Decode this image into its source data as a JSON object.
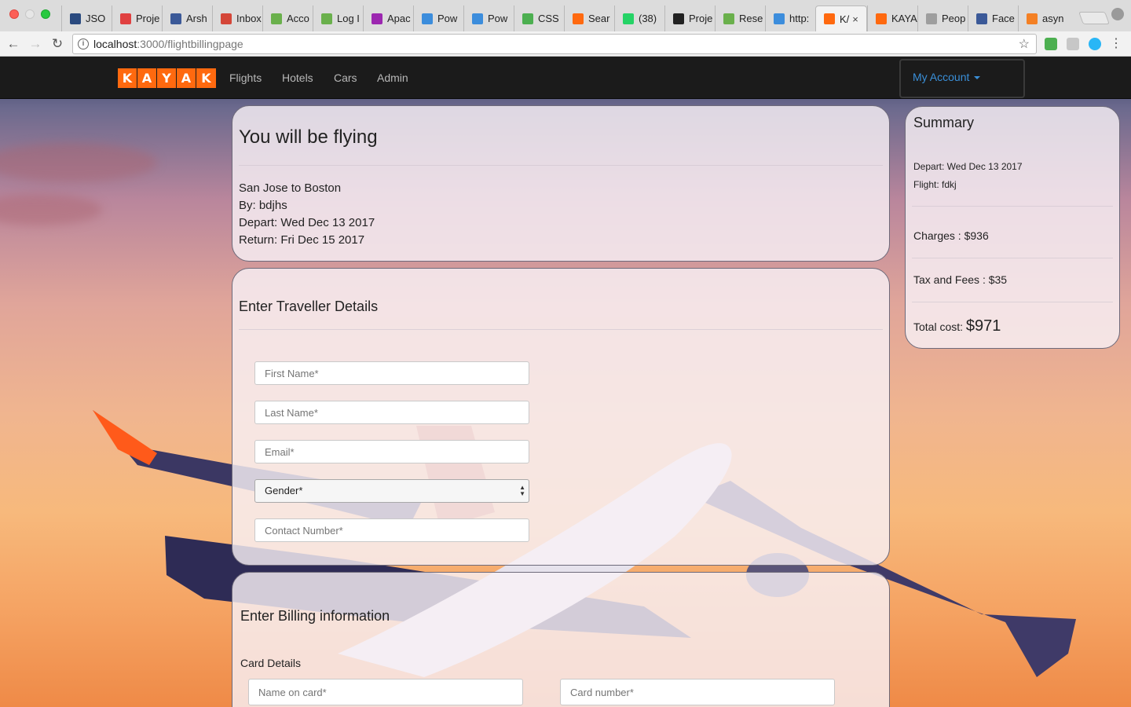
{
  "browser": {
    "tabs": [
      {
        "label": "JSO",
        "fav": "#2a4a7f"
      },
      {
        "label": "Proje",
        "fav": "#e04040"
      },
      {
        "label": "Arsh",
        "fav": "#3b5998"
      },
      {
        "label": "Inbox",
        "fav": "#d44638"
      },
      {
        "label": "Acco",
        "fav": "#6ab04c"
      },
      {
        "label": "Log I",
        "fav": "#6ab04c"
      },
      {
        "label": "Apac",
        "fav": "#9c27b0"
      },
      {
        "label": "Pow",
        "fav": "#3c8ddc"
      },
      {
        "label": "Pow",
        "fav": "#3c8ddc"
      },
      {
        "label": "CSS",
        "fav": "#4caf50"
      },
      {
        "label": "Sear",
        "fav": "#ff690f"
      },
      {
        "label": "(38)",
        "fav": "#25d366"
      },
      {
        "label": "Proje",
        "fav": "#222222"
      },
      {
        "label": "Rese",
        "fav": "#6ab04c"
      },
      {
        "label": "http:",
        "fav": "#3c8ddc"
      },
      {
        "label": "K/",
        "fav": "#ff690f",
        "active": true
      },
      {
        "label": "KAYA",
        "fav": "#ff690f"
      },
      {
        "label": "Peop",
        "fav": "#9e9e9e"
      },
      {
        "label": "Face",
        "fav": "#3b5998"
      },
      {
        "label": "asyn",
        "fav": "#f48024"
      }
    ],
    "close_glyph": "×",
    "url_host": "localhost",
    "url_path": ":3000/flightbillingpage"
  },
  "nav": {
    "logo_letters": [
      "K",
      "A",
      "Y",
      "A",
      "K"
    ],
    "links": [
      "Flights",
      "Hotels",
      "Cars",
      "Admin"
    ],
    "account_label": "My Account"
  },
  "flying": {
    "title": "You will be flying",
    "route": "San Jose to Boston",
    "by": "By: bdjhs",
    "depart": "Depart: Wed Dec 13 2017",
    "return": "Return: Fri Dec 15 2017"
  },
  "traveller": {
    "title": "Enter Traveller Details",
    "first_name_placeholder": "First Name*",
    "last_name_placeholder": "Last Name*",
    "email_placeholder": "Email*",
    "gender_value": "Gender*",
    "contact_placeholder": "Contact Number*"
  },
  "billing": {
    "title": "Enter Billing information",
    "card_details_label": "Card Details",
    "name_on_card_placeholder": "Name on card*",
    "card_number_placeholder": "Card number*"
  },
  "summary": {
    "title": "Summary",
    "depart": "Depart: Wed Dec 13 2017",
    "flight": "Flight: fdkj",
    "charges": "Charges : $936",
    "tax": "Tax and Fees : $35",
    "total_label": "Total cost: ",
    "total_value": "$971"
  },
  "colors": {
    "brand": "#ff690f",
    "navbar": "#1b1b1b",
    "account_link": "#3a8fd8"
  }
}
